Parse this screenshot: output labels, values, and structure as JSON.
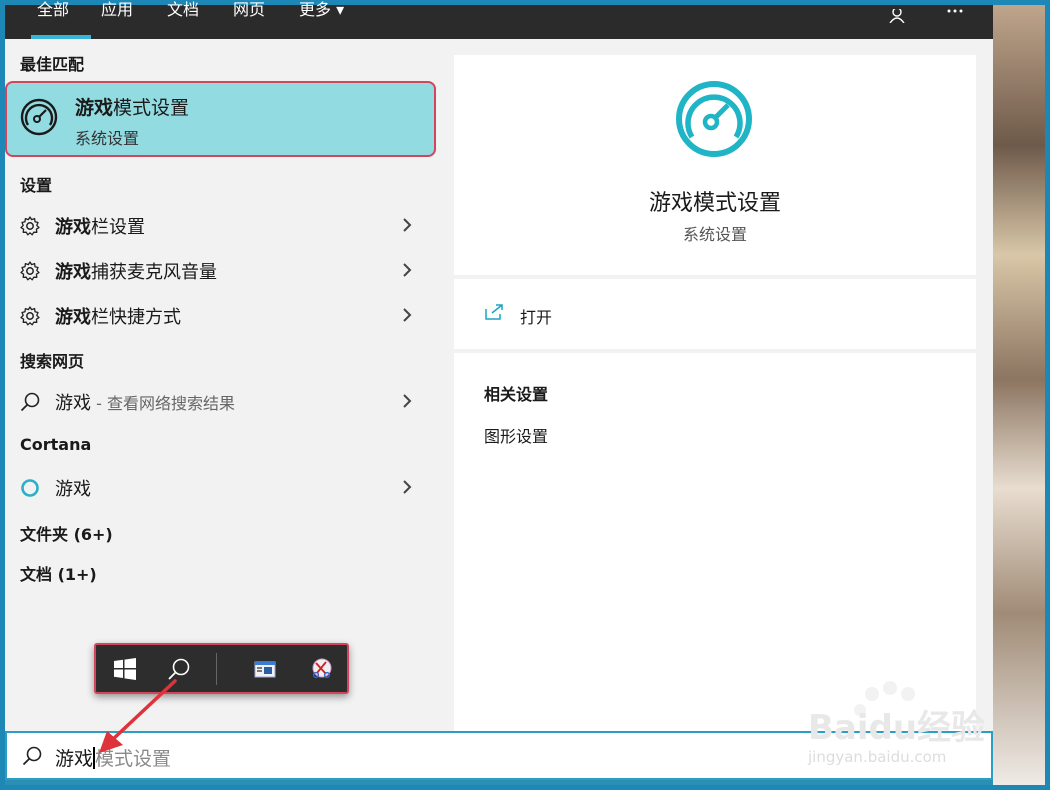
{
  "tabs": [
    {
      "label": "全部"
    },
    {
      "label": "应用"
    },
    {
      "label": "文档"
    },
    {
      "label": "网页"
    },
    {
      "label": "更多 ▾"
    }
  ],
  "left": {
    "best_match_heading": "最佳匹配",
    "best_match": {
      "bold": "游戏",
      "rest": "模式设置",
      "subtitle": "系统设置"
    },
    "settings_heading": "设置",
    "settings_items": [
      {
        "bold": "游戏",
        "rest": "栏设置"
      },
      {
        "bold": "游戏",
        "rest": "捕获麦克风音量"
      },
      {
        "bold": "游戏",
        "rest": "栏快捷方式"
      }
    ],
    "web_heading": "搜索网页",
    "web_item": {
      "text": "游戏",
      "hint": " - 查看网络搜索结果"
    },
    "cortana_heading": "Cortana",
    "cortana_item": {
      "text": "游戏"
    },
    "folders_heading": "文件夹 (6+)",
    "docs_heading": "文档 (1+)"
  },
  "right": {
    "title": "游戏模式设置",
    "subtitle": "系统设置",
    "open_label": "打开",
    "related_heading": "相关设置",
    "related_link": "图形设置"
  },
  "search": {
    "typed": "游戏",
    "suggestion": "模式设置"
  },
  "watermark": {
    "brand": "Baidu经验",
    "url": "jingyan.baidu.com"
  },
  "colors": {
    "accent": "#38b5d6",
    "highlight": "#91dbe1",
    "annotation": "#d2455d",
    "arrow": "#e0323a"
  }
}
